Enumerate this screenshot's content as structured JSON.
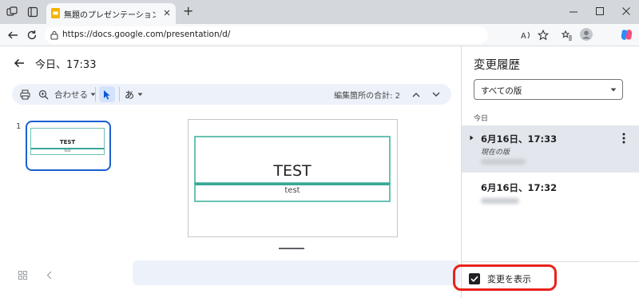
{
  "browser": {
    "tab_title": "無題のプレゼンテーション - Google ス",
    "url": "https://docs.google.com/presentation/d/",
    "new_tab_label": "+"
  },
  "header": {
    "title": "今日、17:33"
  },
  "toolbar": {
    "zoom_label": "合わせる",
    "input_tool_label": "あ",
    "edit_count": "編集箇所の合計: 2"
  },
  "filmstrip": {
    "index": "1",
    "thumb_title": "TEST",
    "thumb_subtitle": "test"
  },
  "slide": {
    "title": "TEST",
    "subtitle": "test"
  },
  "panel": {
    "title": "変更履歴",
    "select_value": "すべての版",
    "section_label": "今日",
    "revisions": [
      {
        "time": "6月16日、17:33",
        "status": "現在の版"
      },
      {
        "time": "6月16日、17:32"
      }
    ],
    "show_changes_label": "変更を表示"
  },
  "colors": {
    "accent": "#1a5fd0",
    "slide_border": "#6ac2b3",
    "annotation": "#e8231a"
  },
  "icons": [
    "workspaces-icon",
    "tab-actions-icon",
    "slides-favicon",
    "close-tab-icon",
    "back-icon",
    "refresh-icon",
    "site-info-icon",
    "read-aloud-icon",
    "favorite-star-icon",
    "favorites-icon",
    "profile-icon",
    "copilot-icon",
    "minimize-icon",
    "maximize-icon",
    "close-window-icon",
    "print-icon",
    "zoom-icon",
    "pointer-icon",
    "chevron-up-icon",
    "chevron-down-icon",
    "grid-view-icon",
    "collapse-icon",
    "more-vert-icon",
    "check-icon"
  ]
}
